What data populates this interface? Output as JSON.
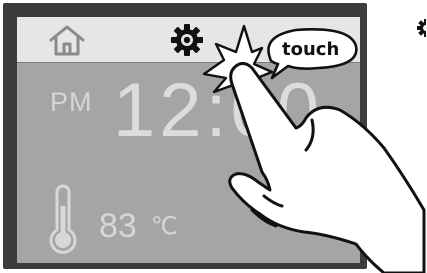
{
  "display": {
    "ampm": "PM",
    "time": "12:00",
    "temperature_value": "83",
    "temperature_unit": "℃"
  },
  "callout": {
    "text": "touch"
  },
  "icons": {
    "top_left": "home-icon",
    "top_center": "gear-icon",
    "temperature": "thermometer-icon",
    "outside_right": "partial-gear-icon"
  },
  "colors": {
    "bezel": "#3c3c3c",
    "screen": "#a5a5a5",
    "topbar": "#e6e6e6",
    "digits": "#dcdcdc"
  }
}
